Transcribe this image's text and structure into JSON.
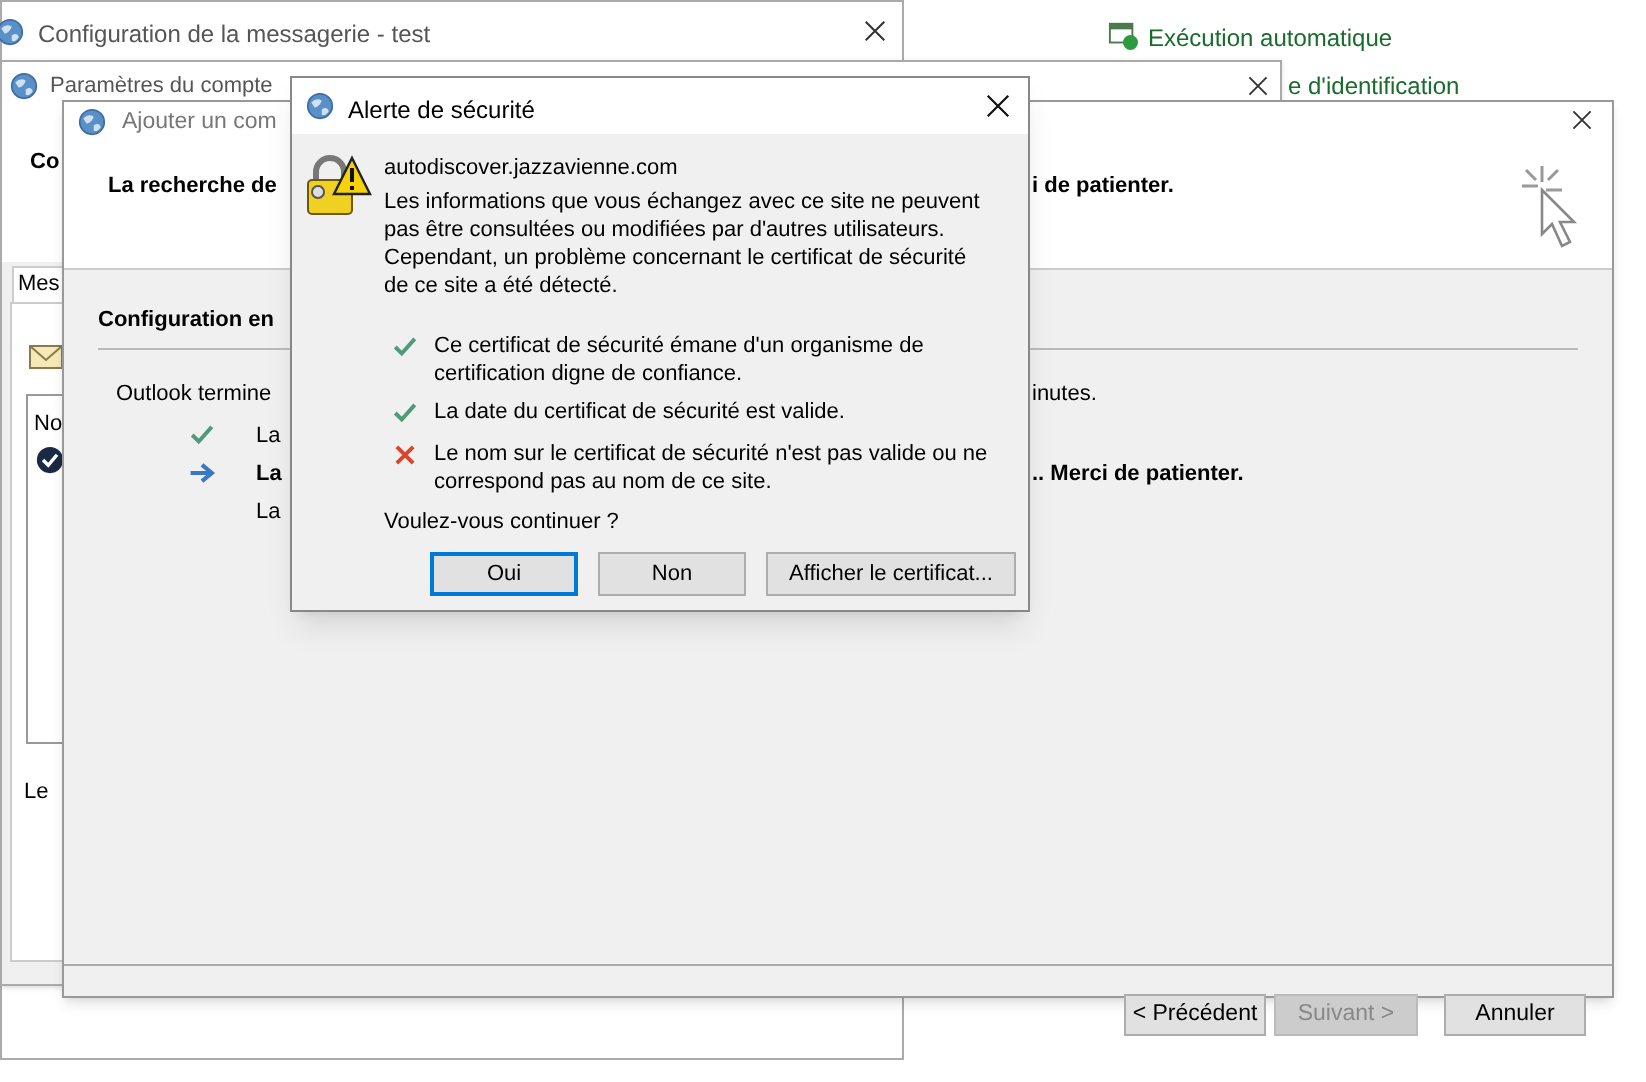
{
  "background_app": {
    "link": "Exécution automatique",
    "link_2": "e d'identification"
  },
  "mail_setup_window": {
    "title": "Configuration de la messagerie - test"
  },
  "account_settings_window": {
    "title": "Paramètres du compte",
    "header_text": "Co",
    "tab": "Mes",
    "list_item": "No",
    "footer_text": "Le"
  },
  "add_account_window": {
    "title": "Ajouter un com",
    "heading_left": "La recherche de",
    "heading_right": "i de patienter.",
    "section_title": "Configuration en",
    "intro_left": "Outlook termine",
    "intro_right": "inutes.",
    "steps": [
      {
        "kind": "done",
        "text": "La"
      },
      {
        "kind": "current",
        "text": "La",
        "text_right": ".. Merci de patienter."
      },
      {
        "kind": "pending",
        "text": "La"
      }
    ],
    "buttons": [
      {
        "label": "< Précédent",
        "disabled": false
      },
      {
        "label": "Suivant >",
        "disabled": true
      },
      {
        "label": "Annuler",
        "disabled": false
      }
    ]
  },
  "security_alert": {
    "title": "Alerte de sécurité",
    "host": "autodiscover.jazzavienne.com",
    "message": "Les informations que vous échangez avec ce site ne peuvent pas être consultées ou modifiées par d'autres utilisateurs. Cependant, un problème concernant le certificat de sécurité de ce site a été détecté.",
    "checks": [
      {
        "kind": "ok",
        "text": "Ce certificat de sécurité émane d'un organisme de certification digne de confiance."
      },
      {
        "kind": "ok",
        "text": "La date du certificat de sécurité est valide."
      },
      {
        "kind": "fail",
        "text": "Le nom sur le certificat de sécurité n'est pas valide ou ne correspond pas au nom de ce site."
      }
    ],
    "question": "Voulez-vous continuer ?",
    "buttons": [
      {
        "label": "Oui",
        "selected": true
      },
      {
        "label": "Non",
        "selected": false
      },
      {
        "label": "Afficher le certificat...",
        "selected": false
      }
    ]
  }
}
